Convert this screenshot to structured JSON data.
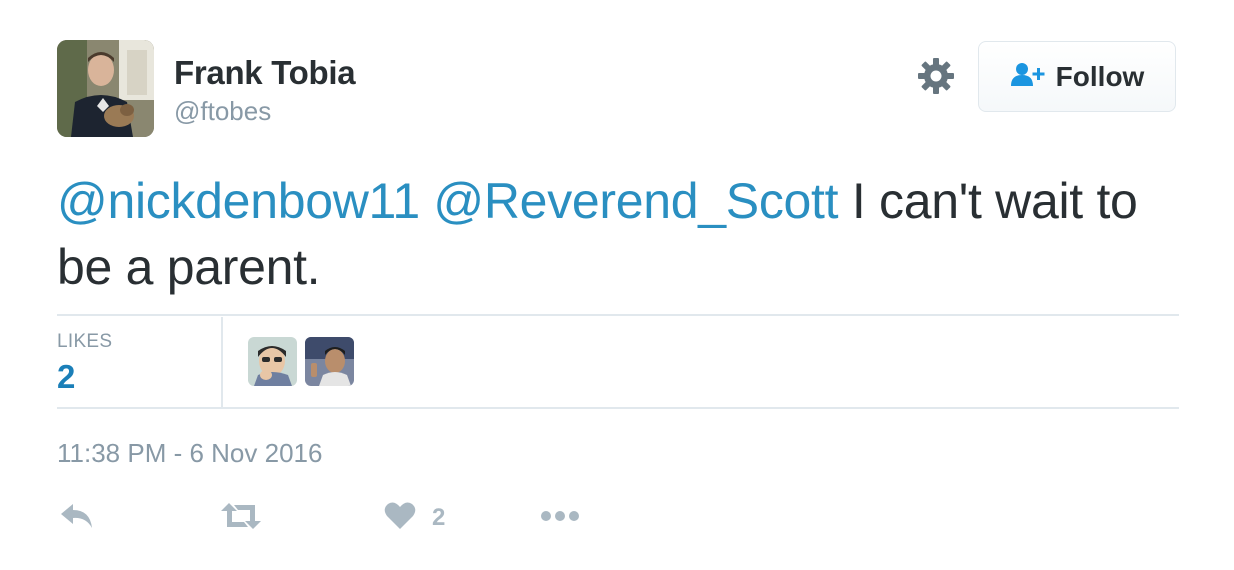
{
  "user": {
    "name": "Frank Tobia",
    "handle": "@ftobes",
    "avatar_icon": "profile-photo"
  },
  "follow_button": {
    "label": "Follow",
    "icon": "add-user-icon"
  },
  "tweet": {
    "mentions": [
      "@nickdenbow11",
      "@Reverend_Scott"
    ],
    "text": " I can't wait to be a parent."
  },
  "stats": {
    "likes_label": "LIKES",
    "likes_count": "2"
  },
  "timestamp": "11:38 PM - 6 Nov 2016",
  "actions": {
    "like_count": "2"
  },
  "colors": {
    "link": "#2a8fc1",
    "muted": "#8899a6",
    "icon": "#aab8c2",
    "text": "#292f33"
  }
}
